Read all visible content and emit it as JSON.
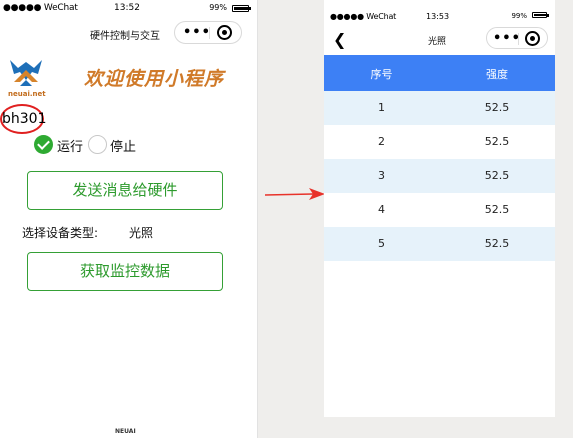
{
  "left_phone": {
    "status": {
      "carrier": "●●●●● WeChat",
      "time": "13:52",
      "battery": "99%",
      "battery_level": 0.95
    },
    "nav_title": "硬件控制与交互",
    "capsule": {
      "menu": "•••"
    },
    "logo_text": "neuai.net",
    "welcome": "欢迎使用小程序",
    "device_id": "bh301",
    "radio": {
      "run": "运行",
      "stop": "停止",
      "selected": "运行"
    },
    "send_button": "发送消息给硬件",
    "device_type_label": "选择设备类型:",
    "device_type_value": "光照",
    "monitor_button": "获取监控数据",
    "footer": "NEUAI"
  },
  "right_phone": {
    "status": {
      "carrier": "●●●●● WeChat",
      "time": "13:53",
      "battery": "99%",
      "battery_level": 0.95
    },
    "back_icon": "chevron-left-icon",
    "nav_title": "光照",
    "capsule": {
      "menu": "•••"
    },
    "table": {
      "headers": [
        "序号",
        "强度"
      ],
      "rows": [
        [
          "1",
          "52.5"
        ],
        [
          "2",
          "52.5"
        ],
        [
          "3",
          "52.5"
        ],
        [
          "4",
          "52.5"
        ],
        [
          "5",
          "52.5"
        ]
      ]
    }
  },
  "colors": {
    "accent_green": "#2c9a2c",
    "header_blue": "#3d80f5",
    "row_alt": "#e6f2fa",
    "welcome_orange": "#d07a29",
    "highlight_red": "#e02020"
  }
}
